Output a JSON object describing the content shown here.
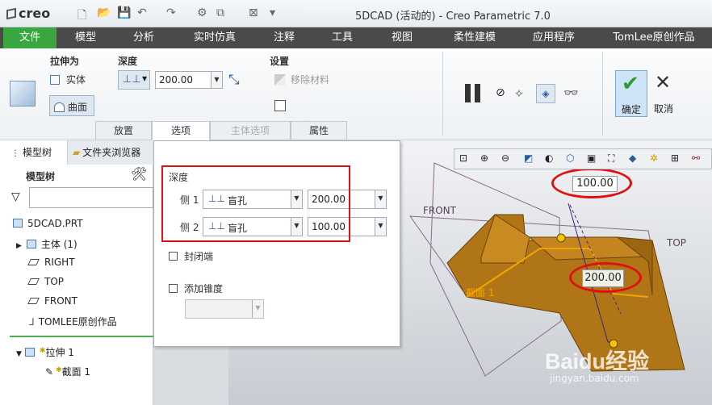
{
  "app": {
    "logo": "creo",
    "title": "5DCAD (活动的) - Creo Parametric 7.0"
  },
  "menu": [
    "文件",
    "模型",
    "分析",
    "实时仿真",
    "注释",
    "工具",
    "视图",
    "柔性建模",
    "应用程序",
    "TomLee原创作品"
  ],
  "ribbon": {
    "extrude_as": "拉伸为",
    "solid": "实体",
    "surface": "曲面",
    "depth": "深度",
    "depth_value": "200.00",
    "settings": "设置",
    "remove_material": "移除材料",
    "ok": "确定",
    "cancel": "取消"
  },
  "tabs": [
    "放置",
    "选项",
    "主体选项",
    "属性"
  ],
  "panel": {
    "tab_model_tree": "模型树",
    "tab_folder": "文件夹浏览器",
    "header": "模型树",
    "root": "5DCAD.PRT",
    "items": [
      "主体 (1)",
      "RIGHT",
      "TOP",
      "FRONT",
      "TOMLEE原创作品"
    ],
    "feature": "拉伸 1",
    "sketch": "截面 1"
  },
  "options": {
    "depth_label": "深度",
    "side1": "侧 1",
    "side1_type": "盲孔",
    "side1_value": "200.00",
    "side2": "侧 2",
    "side2_type": "盲孔",
    "side2_value": "100.00",
    "capped": "封闭端",
    "taper": "添加锥度"
  },
  "viewport": {
    "front": "FRONT",
    "top": "TOP",
    "dim_top": "100.00",
    "dim_bottom": "200.00",
    "section": "截面 1"
  },
  "watermark": {
    "brand": "Baidu经验",
    "url": "jingyan.baidu.com"
  }
}
